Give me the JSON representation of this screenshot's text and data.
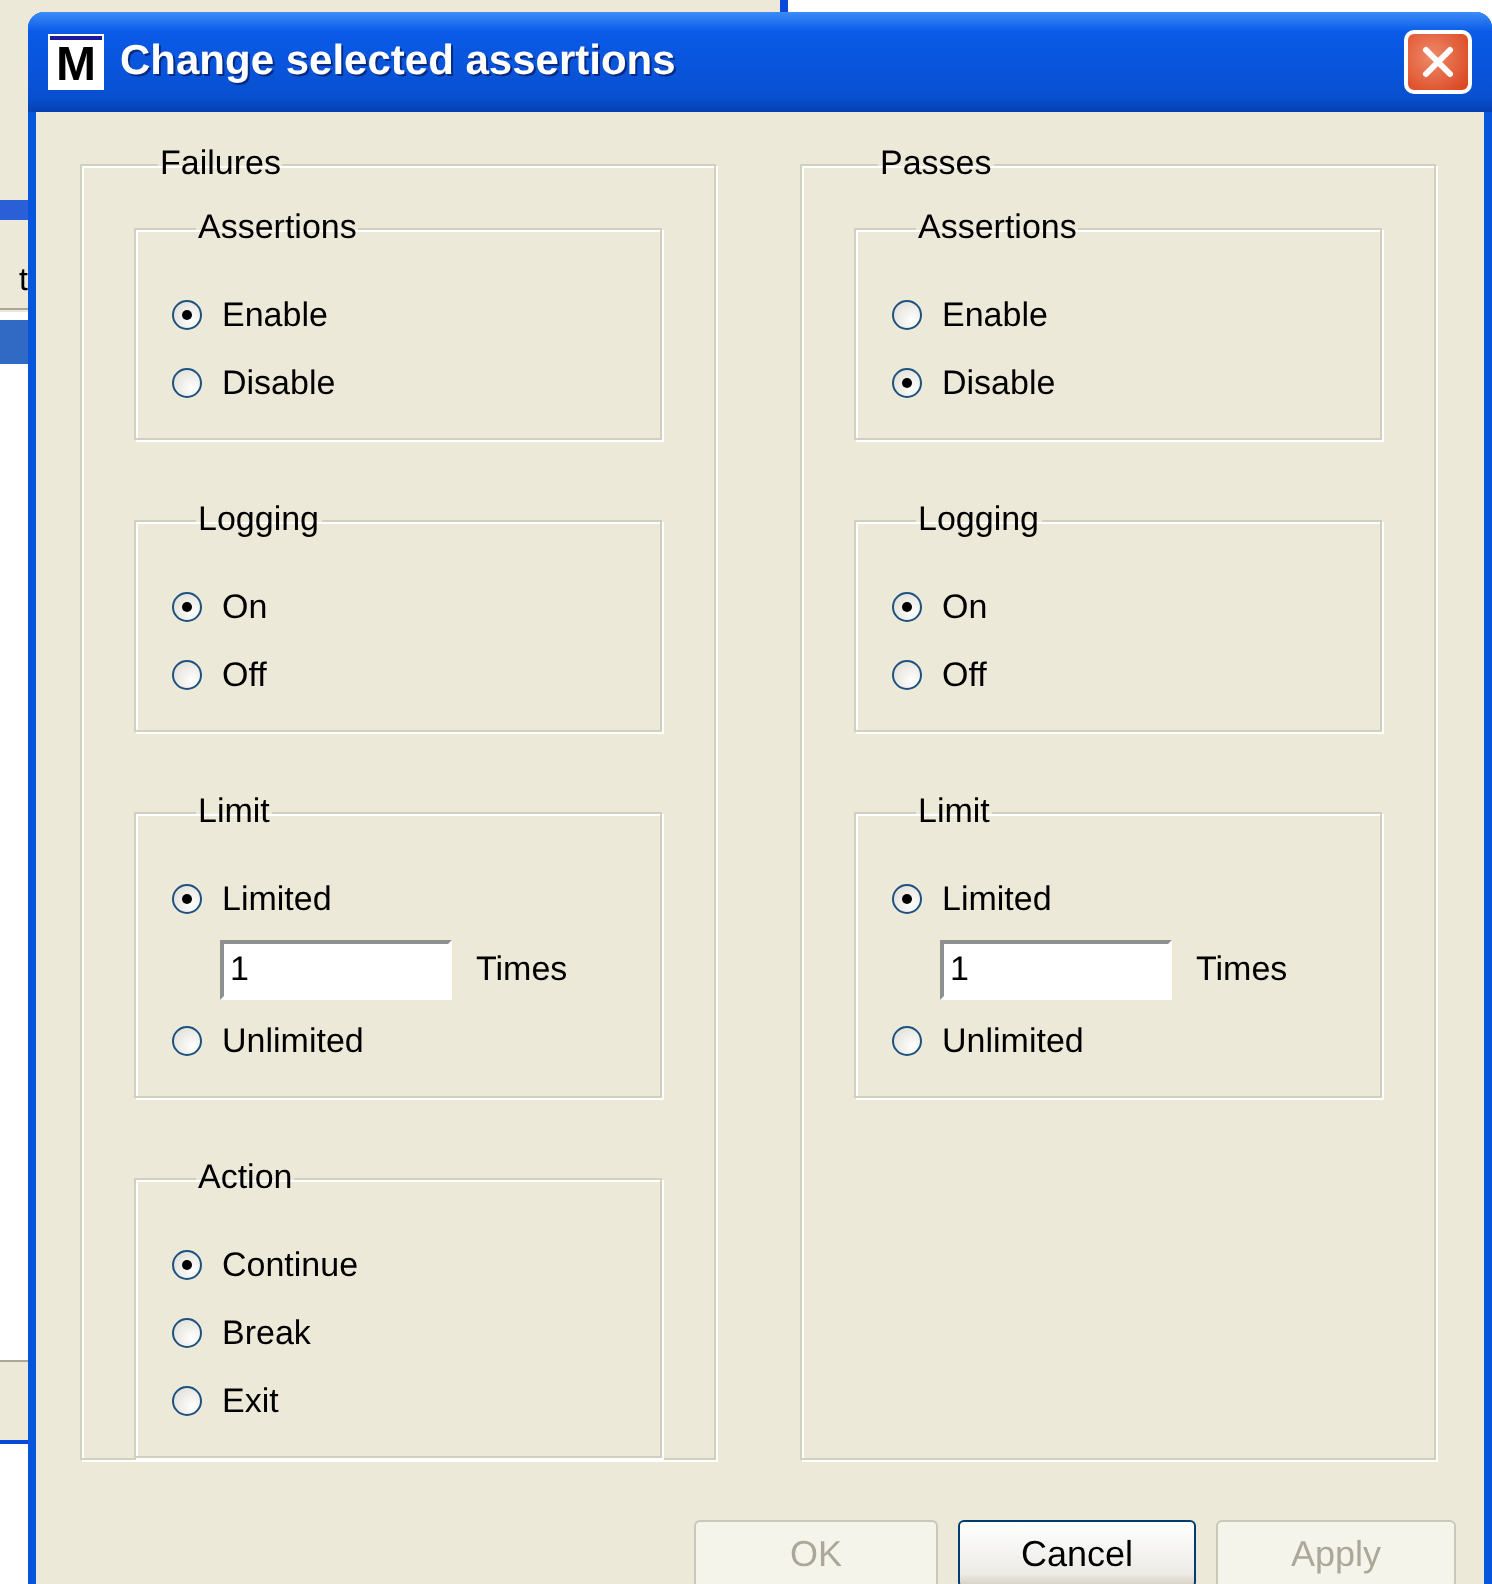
{
  "background_window": {
    "column_header": "t"
  },
  "window": {
    "icon_letter": "M",
    "title": "Change selected assertions"
  },
  "panels": [
    {
      "title": "Failures",
      "groups": [
        {
          "title": "Assertions",
          "options": [
            {
              "kind": "radio",
              "label": "Enable",
              "selected": true
            },
            {
              "kind": "radio",
              "label": "Disable",
              "selected": false
            }
          ]
        },
        {
          "title": "Logging",
          "options": [
            {
              "kind": "radio",
              "label": "On",
              "selected": true
            },
            {
              "kind": "radio",
              "label": "Off",
              "selected": false
            }
          ]
        },
        {
          "title": "Limit",
          "options": [
            {
              "kind": "radio",
              "label": "Limited",
              "selected": true
            },
            {
              "kind": "count",
              "value": "1",
              "unit": "Times"
            },
            {
              "kind": "radio",
              "label": "Unlimited",
              "selected": false
            }
          ]
        },
        {
          "title": "Action",
          "options": [
            {
              "kind": "radio",
              "label": "Continue",
              "selected": true
            },
            {
              "kind": "radio",
              "label": "Break",
              "selected": false
            },
            {
              "kind": "radio",
              "label": "Exit",
              "selected": false
            }
          ]
        }
      ]
    },
    {
      "title": "Passes",
      "groups": [
        {
          "title": "Assertions",
          "options": [
            {
              "kind": "radio",
              "label": "Enable",
              "selected": false
            },
            {
              "kind": "radio",
              "label": "Disable",
              "selected": true
            }
          ]
        },
        {
          "title": "Logging",
          "options": [
            {
              "kind": "radio",
              "label": "On",
              "selected": true
            },
            {
              "kind": "radio",
              "label": "Off",
              "selected": false
            }
          ]
        },
        {
          "title": "Limit",
          "options": [
            {
              "kind": "radio",
              "label": "Limited",
              "selected": true
            },
            {
              "kind": "count",
              "value": "1",
              "unit": "Times"
            },
            {
              "kind": "radio",
              "label": "Unlimited",
              "selected": false
            }
          ]
        }
      ]
    }
  ],
  "buttons": [
    {
      "label": "OK",
      "disabled": true
    },
    {
      "label": "Cancel",
      "disabled": false
    },
    {
      "label": "Apply",
      "disabled": true
    }
  ]
}
